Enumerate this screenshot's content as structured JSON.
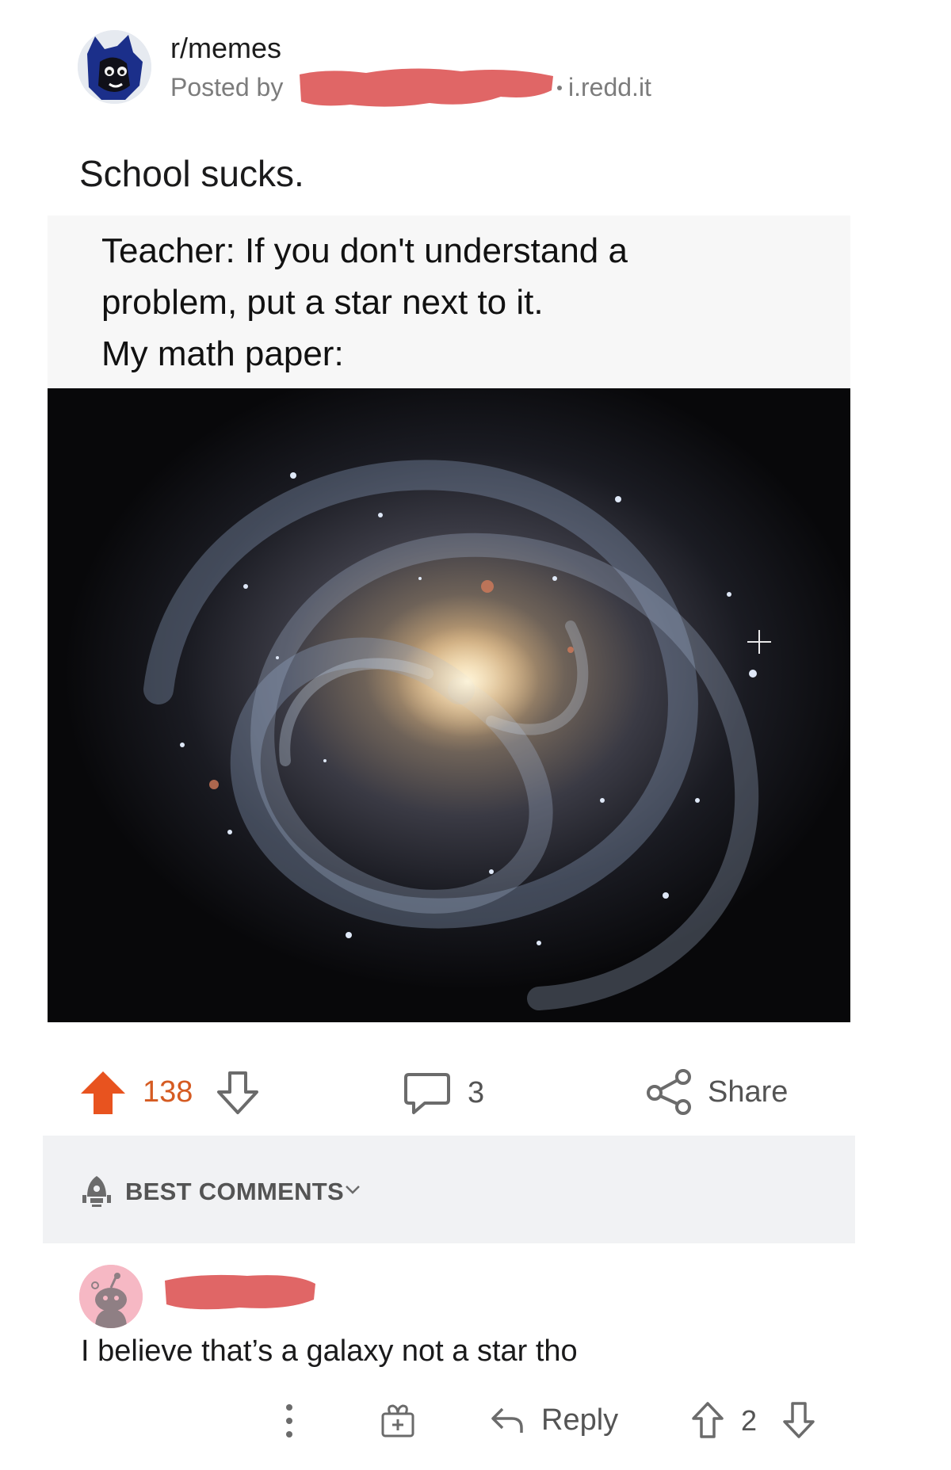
{
  "post": {
    "subreddit": "r/memes",
    "posted_by_label": "Posted by",
    "domain": "i.redd.it",
    "title": "School sucks.",
    "meme_lines": [
      "Teacher: If you don't understand a",
      "problem, put a star next to it.",
      "My math paper:"
    ],
    "image_icon": "spiral-galaxy-image"
  },
  "actions": {
    "score": "138",
    "comment_count": "3",
    "share_label": "Share",
    "upvote_color": "#e8531f"
  },
  "sort": {
    "label": "BEST COMMENTS"
  },
  "comment": {
    "text": "I believe that’s a galaxy not a star tho",
    "reply_label": "Reply",
    "score": "2"
  },
  "colors": {
    "redaction": "#e06666",
    "accent_orange": "#e8531f",
    "muted_text": "#7c7c7c"
  }
}
